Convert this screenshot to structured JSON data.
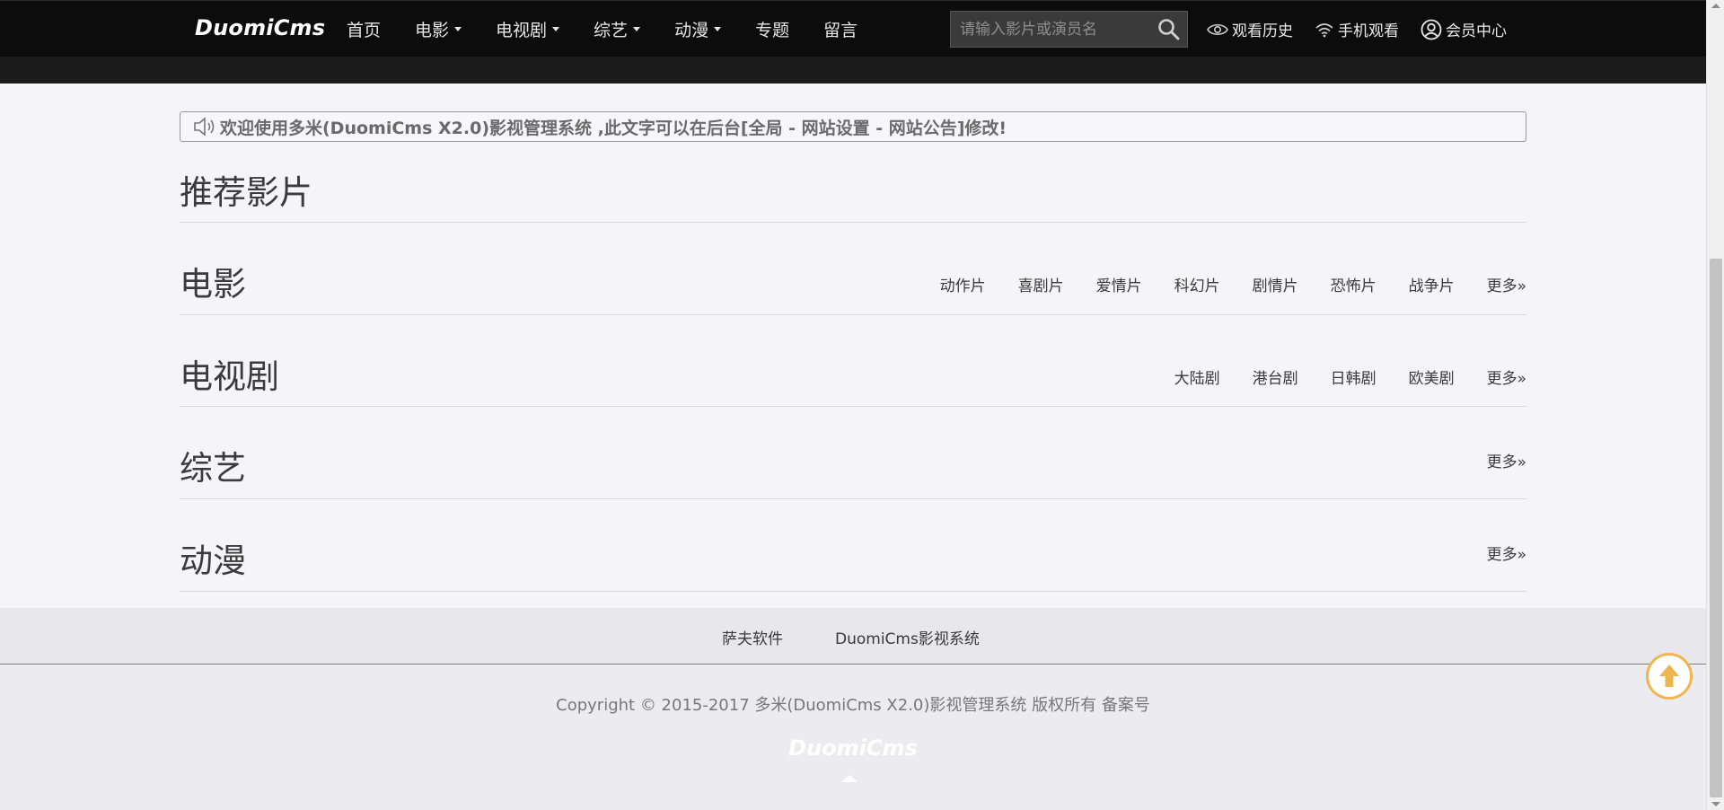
{
  "header": {
    "logo": "DuomiCms",
    "nav": [
      {
        "label": "首页",
        "dropdown": false
      },
      {
        "label": "电影",
        "dropdown": true
      },
      {
        "label": "电视剧",
        "dropdown": true
      },
      {
        "label": "综艺",
        "dropdown": true
      },
      {
        "label": "动漫",
        "dropdown": true
      },
      {
        "label": "专题",
        "dropdown": false
      },
      {
        "label": "留言",
        "dropdown": false
      }
    ],
    "search": {
      "placeholder": "请输入影片或演员名",
      "value": ""
    },
    "user_links": {
      "history": "观看历史",
      "mobile": "手机观看",
      "member": "会员中心"
    }
  },
  "notice": {
    "text": "欢迎使用多米(DuomiCms X2.0)影视管理系统 ,此文字可以在后台[全局 - 网站设置 - 网站公告]修改!",
    "icon": "speaker-icon"
  },
  "sections": [
    {
      "title": "推荐影片",
      "links": []
    },
    {
      "title": "电影",
      "links": [
        "动作片",
        "喜剧片",
        "爱情片",
        "科幻片",
        "剧情片",
        "恐怖片",
        "战争片",
        "更多»"
      ]
    },
    {
      "title": "电视剧",
      "links": [
        "大陆剧",
        "港台剧",
        "日韩剧",
        "欧美剧",
        "更多»"
      ]
    },
    {
      "title": "综艺",
      "links": [
        "更多»"
      ]
    },
    {
      "title": "动漫",
      "links": [
        "更多»"
      ]
    }
  ],
  "footer": {
    "links": [
      "萨夫软件",
      "DuomiCms影视系统"
    ],
    "copyright": "Copyright © 2015-2017 多米(DuomiCms X2.0)影视管理系统 版权所有 备案号",
    "logo": "DuomiCms"
  },
  "colors": {
    "topbar": "#0c0c0c",
    "accent_back_top": "#f1b550",
    "page_bg": "#f5f5f7"
  }
}
